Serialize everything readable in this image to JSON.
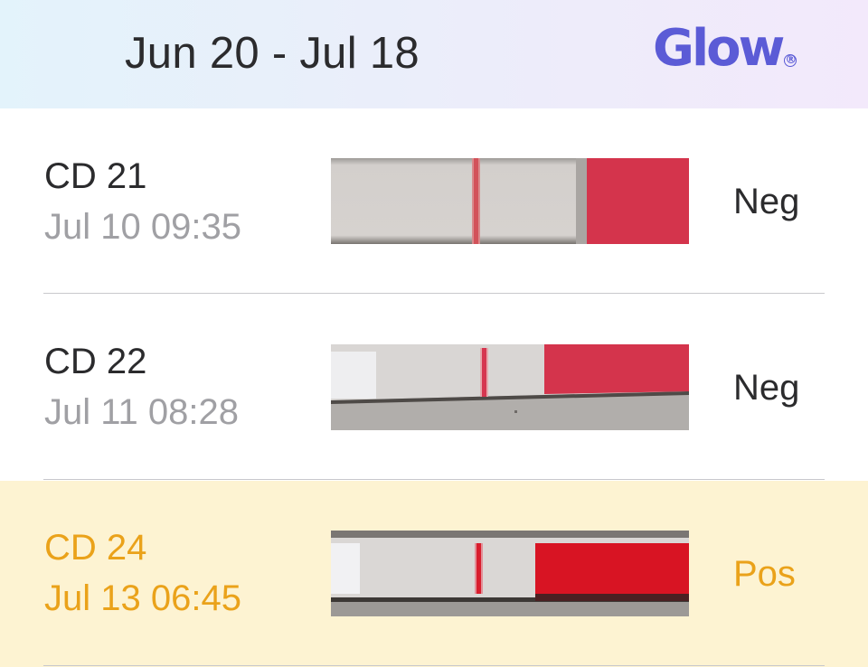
{
  "header": {
    "cycle_range": "Jun 20 - Jul 18",
    "logo_text": "Glow",
    "logo_mark": "®"
  },
  "colors": {
    "logo": "#5b5bd6",
    "positive_text": "#eaa21a",
    "positive_row_bg": "#fdf3d2",
    "secondary_text": "#a0a0a4"
  },
  "tests": [
    {
      "cycle_day": "CD 21",
      "timestamp": "Jul 10 09:35",
      "result": "Neg",
      "highlighted": false
    },
    {
      "cycle_day": "CD 22",
      "timestamp": "Jul 11 08:28",
      "result": "Neg",
      "highlighted": false
    },
    {
      "cycle_day": "CD 24",
      "timestamp": "Jul 13 06:45",
      "result": "Pos",
      "highlighted": true
    }
  ]
}
